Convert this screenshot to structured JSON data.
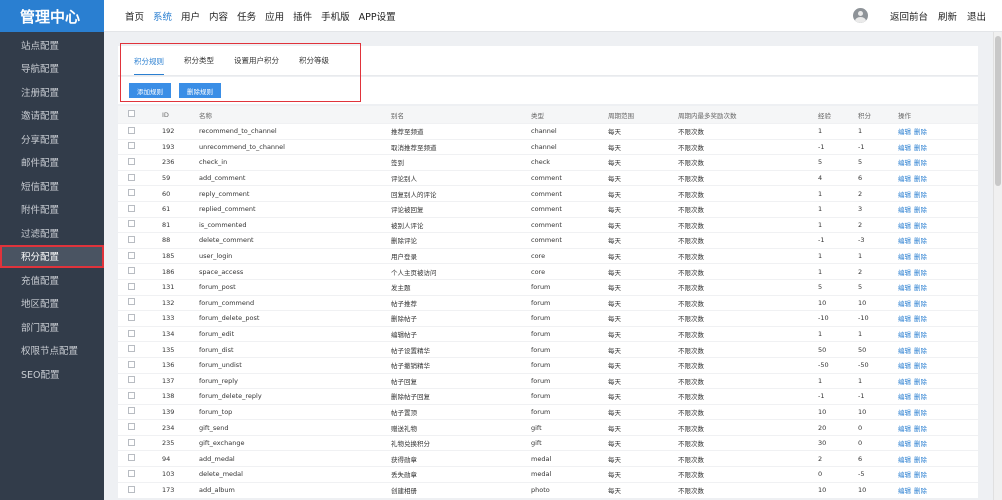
{
  "brand": "管理中心",
  "sidebar": {
    "items": [
      {
        "label": "站点配置",
        "active": false
      },
      {
        "label": "导航配置",
        "active": false
      },
      {
        "label": "注册配置",
        "active": false
      },
      {
        "label": "邀请配置",
        "active": false
      },
      {
        "label": "分享配置",
        "active": false
      },
      {
        "label": "邮件配置",
        "active": false
      },
      {
        "label": "短信配置",
        "active": false
      },
      {
        "label": "附件配置",
        "active": false
      },
      {
        "label": "过滤配置",
        "active": false
      },
      {
        "label": "积分配置",
        "active": true
      },
      {
        "label": "充值配置",
        "active": false
      },
      {
        "label": "地区配置",
        "active": false
      },
      {
        "label": "部门配置",
        "active": false
      },
      {
        "label": "权限节点配置",
        "active": false
      },
      {
        "label": "SEO配置",
        "active": false
      }
    ]
  },
  "topnav": {
    "items": [
      {
        "label": "首页",
        "active": false
      },
      {
        "label": "系统",
        "active": true
      },
      {
        "label": "用户",
        "active": false
      },
      {
        "label": "内容",
        "active": false
      },
      {
        "label": "任务",
        "active": false
      },
      {
        "label": "应用",
        "active": false
      },
      {
        "label": "插件",
        "active": false
      },
      {
        "label": "手机版",
        "active": false
      },
      {
        "label": "APP设置",
        "active": false
      }
    ],
    "back_label": "返回前台",
    "refresh_label": "刷新",
    "logout_label": "退出"
  },
  "tabs": [
    {
      "label": "积分规则",
      "active": true
    },
    {
      "label": "积分类型",
      "active": false
    },
    {
      "label": "设置用户积分",
      "active": false
    },
    {
      "label": "积分等级",
      "active": false
    }
  ],
  "actions": {
    "add_label": "添加规则",
    "delete_label": "删除规则"
  },
  "table": {
    "headers": [
      "ID",
      "名称",
      "别名",
      "类型",
      "周期范围",
      "周期内最多奖励次数",
      "经验",
      "积分",
      "操作"
    ],
    "edit_label": "编辑",
    "delete_label": "删除",
    "rows": [
      [
        "192",
        "recommend_to_channel",
        "推荐至频道",
        "channel",
        "每天",
        "不限次数",
        "1",
        "1"
      ],
      [
        "193",
        "unrecommend_to_channel",
        "取消推荐至频道",
        "channel",
        "每天",
        "不限次数",
        "-1",
        "-1"
      ],
      [
        "236",
        "check_in",
        "签到",
        "check",
        "每天",
        "不限次数",
        "5",
        "5"
      ],
      [
        "59",
        "add_comment",
        "评论别人",
        "comment",
        "每天",
        "不限次数",
        "4",
        "6"
      ],
      [
        "60",
        "reply_comment",
        "回复别人的评论",
        "comment",
        "每天",
        "不限次数",
        "1",
        "2"
      ],
      [
        "61",
        "replied_comment",
        "评论被回复",
        "comment",
        "每天",
        "不限次数",
        "1",
        "3"
      ],
      [
        "81",
        "is_commented",
        "被别人评论",
        "comment",
        "每天",
        "不限次数",
        "1",
        "2"
      ],
      [
        "88",
        "delete_comment",
        "删除评论",
        "comment",
        "每天",
        "不限次数",
        "-1",
        "-3"
      ],
      [
        "185",
        "user_login",
        "用户登录",
        "core",
        "每天",
        "不限次数",
        "1",
        "1"
      ],
      [
        "186",
        "space_access",
        "个人主页被访问",
        "core",
        "每天",
        "不限次数",
        "1",
        "2"
      ],
      [
        "131",
        "forum_post",
        "发主题",
        "forum",
        "每天",
        "不限次数",
        "5",
        "5"
      ],
      [
        "132",
        "forum_commend",
        "帖子推荐",
        "forum",
        "每天",
        "不限次数",
        "10",
        "10"
      ],
      [
        "133",
        "forum_delete_post",
        "删除帖子",
        "forum",
        "每天",
        "不限次数",
        "-10",
        "-10"
      ],
      [
        "134",
        "forum_edit",
        "编辑帖子",
        "forum",
        "每天",
        "不限次数",
        "1",
        "1"
      ],
      [
        "135",
        "forum_dist",
        "帖子设置精华",
        "forum",
        "每天",
        "不限次数",
        "50",
        "50"
      ],
      [
        "136",
        "forum_undist",
        "帖子撤销精华",
        "forum",
        "每天",
        "不限次数",
        "-50",
        "-50"
      ],
      [
        "137",
        "forum_reply",
        "帖子回复",
        "forum",
        "每天",
        "不限次数",
        "1",
        "1"
      ],
      [
        "138",
        "forum_delete_reply",
        "删除帖子回复",
        "forum",
        "每天",
        "不限次数",
        "-1",
        "-1"
      ],
      [
        "139",
        "forum_top",
        "帖子置顶",
        "forum",
        "每天",
        "不限次数",
        "10",
        "10"
      ],
      [
        "234",
        "gift_send",
        "赠送礼物",
        "gift",
        "每天",
        "不限次数",
        "20",
        "0"
      ],
      [
        "235",
        "gift_exchange",
        "礼物兑换积分",
        "gift",
        "每天",
        "不限次数",
        "30",
        "0"
      ],
      [
        "94",
        "add_medal",
        "获得勋章",
        "medal",
        "每天",
        "不限次数",
        "2",
        "6"
      ],
      [
        "103",
        "delete_medal",
        "丢失勋章",
        "medal",
        "每天",
        "不限次数",
        "0",
        "-5"
      ],
      [
        "173",
        "add_album",
        "创建相册",
        "photo",
        "每天",
        "不限次数",
        "10",
        "10"
      ]
    ]
  },
  "colors": {
    "sidebar_bg": "#323c4a",
    "brand_bg": "#2a7fd1",
    "accent": "#2a7fd1",
    "highlight_border": "#e0333b",
    "button_bg": "#3a8ee6"
  }
}
